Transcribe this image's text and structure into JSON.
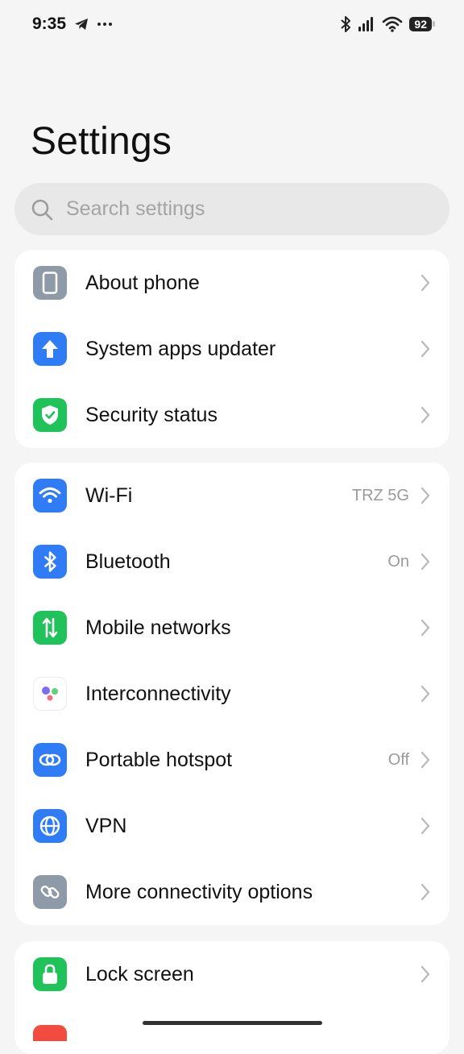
{
  "status_bar": {
    "time": "9:35",
    "battery": "92",
    "icons": [
      "telegram-icon",
      "more-dots-icon",
      "bluetooth-icon",
      "signal-icon",
      "wifi-icon",
      "battery-icon"
    ]
  },
  "header": {
    "title": "Settings"
  },
  "search": {
    "placeholder": "Search settings"
  },
  "groups": [
    {
      "items": [
        {
          "label": "About phone",
          "value": "",
          "icon": "phone-icon",
          "color": "#8e9aa8"
        },
        {
          "label": "System apps updater",
          "value": "",
          "icon": "arrow-up-icon",
          "color": "#2f7cf6"
        },
        {
          "label": "Security status",
          "value": "",
          "icon": "shield-check-icon",
          "color": "#1fc35a"
        }
      ]
    },
    {
      "items": [
        {
          "label": "Wi-Fi",
          "value": "TRZ 5G",
          "icon": "wifi-icon",
          "color": "#2f7cf6"
        },
        {
          "label": "Bluetooth",
          "value": "On",
          "icon": "bluetooth-icon",
          "color": "#2f7cf6"
        },
        {
          "label": "Mobile networks",
          "value": "",
          "icon": "mobile-data-icon",
          "color": "#1fc35a"
        },
        {
          "label": "Interconnectivity",
          "value": "",
          "icon": "interconnectivity-icon",
          "color": "#ffffff"
        },
        {
          "label": "Portable hotspot",
          "value": "Off",
          "icon": "hotspot-icon",
          "color": "#2f7cf6"
        },
        {
          "label": "VPN",
          "value": "",
          "icon": "globe-icon",
          "color": "#2f7cf6"
        },
        {
          "label": "More connectivity options",
          "value": "",
          "icon": "link-icon",
          "color": "#8e9aa8"
        }
      ]
    },
    {
      "items": [
        {
          "label": "Lock screen",
          "value": "",
          "icon": "lock-icon",
          "color": "#1fc35a"
        }
      ]
    }
  ]
}
